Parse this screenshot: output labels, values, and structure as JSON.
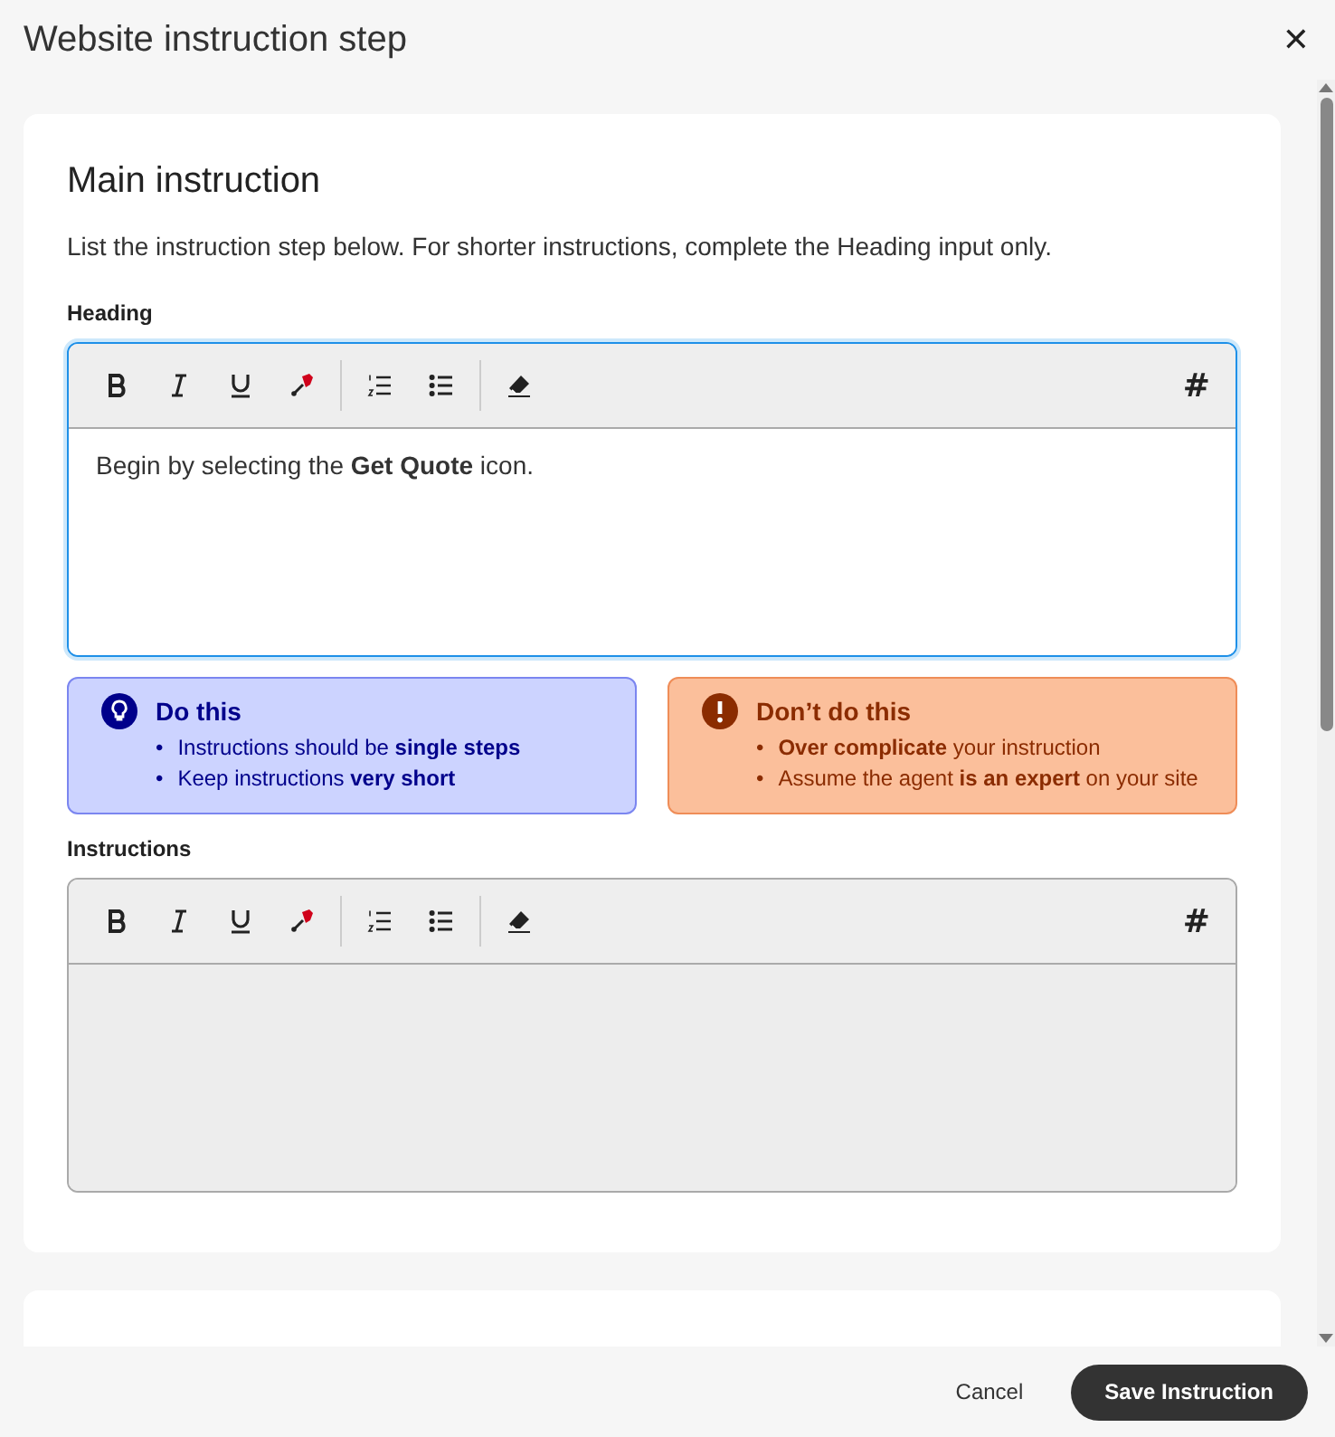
{
  "dialog": {
    "title": "Website instruction step",
    "close": "✕"
  },
  "main_card": {
    "title": "Main instruction",
    "description": "List the instruction step below. For shorter instructions, complete the Heading input only.",
    "editors": [
      {
        "label": "Heading",
        "focused": true,
        "disabled": false,
        "insert": "#",
        "value": "Begin by selecting the **Get Quote** icon."
      },
      {
        "label": "Instructions",
        "focused": false,
        "disabled": true,
        "insert": "#"
      }
    ],
    "tips": [
      {
        "kind": "do",
        "title": "Do this",
        "bullet": "•",
        "items": [
          "Instructions should be **single steps**",
          "Keep instructions **very short**"
        ]
      },
      {
        "kind": "dont",
        "title": "Don’t do this",
        "bullet": "•",
        "items": [
          "**Over complicate** your instruction",
          "Assume the agent **is an expert** on your site"
        ]
      }
    ]
  },
  "footer": {
    "buttons": [
      {
        "kind": "text",
        "label": "Cancel"
      },
      {
        "kind": "primary",
        "label": "Save Instruction"
      }
    ]
  }
}
